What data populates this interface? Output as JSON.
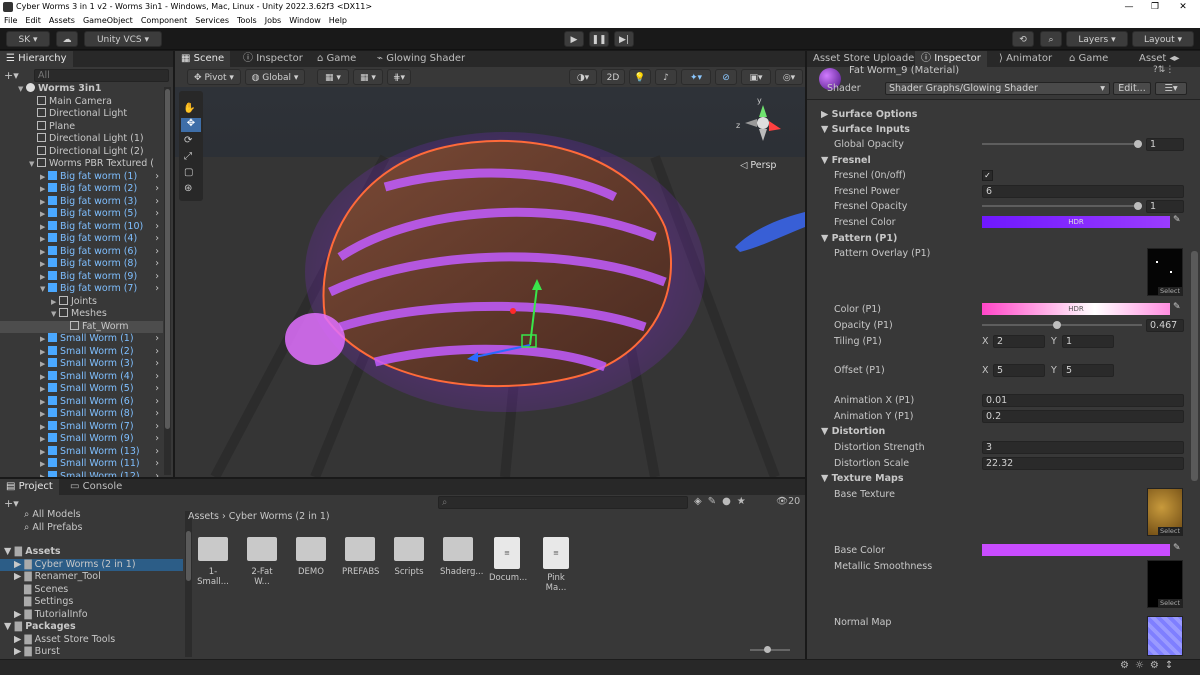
{
  "window": {
    "title": "Cyber Worms 3 in 1 v2 - Worms 3in1 - Windows, Mac, Linux - Unity 2022.3.62f3 <DX11>"
  },
  "menu": [
    "File",
    "Edit",
    "Assets",
    "GameObject",
    "Component",
    "Services",
    "Tools",
    "Jobs",
    "Window",
    "Help"
  ],
  "toolbar": {
    "account": "SK",
    "vcs": "Unity VCS",
    "layers": "Layers",
    "layout": "Layout"
  },
  "hierarchy": {
    "tab": "Hierarchy",
    "search_placeholder": "All",
    "rows": [
      {
        "label": "Worms 3in1",
        "kind": "scene",
        "indent": 0,
        "arrow": "▼"
      },
      {
        "label": "Main Camera",
        "kind": "obj",
        "indent": 1,
        "arrow": ""
      },
      {
        "label": "Directional Light",
        "kind": "obj",
        "indent": 1,
        "arrow": ""
      },
      {
        "label": "Plane",
        "kind": "obj",
        "indent": 1,
        "arrow": ""
      },
      {
        "label": "Directional Light (1)",
        "kind": "obj",
        "indent": 1,
        "arrow": ""
      },
      {
        "label": "Directional Light (2)",
        "kind": "obj",
        "indent": 1,
        "arrow": ""
      },
      {
        "label": "Worms PBR Textured (",
        "kind": "obj",
        "indent": 1,
        "arrow": "▼"
      },
      {
        "label": "Big fat worm (1)",
        "kind": "prefab",
        "indent": 2,
        "arrow": "▶"
      },
      {
        "label": "Big fat worm (2)",
        "kind": "prefab",
        "indent": 2,
        "arrow": "▶"
      },
      {
        "label": "Big fat worm (3)",
        "kind": "prefab",
        "indent": 2,
        "arrow": "▶"
      },
      {
        "label": "Big fat worm (5)",
        "kind": "prefab",
        "indent": 2,
        "arrow": "▶"
      },
      {
        "label": "Big fat worm (10)",
        "kind": "prefab",
        "indent": 2,
        "arrow": "▶"
      },
      {
        "label": "Big fat worm (4)",
        "kind": "prefab",
        "indent": 2,
        "arrow": "▶"
      },
      {
        "label": "Big fat worm (6)",
        "kind": "prefab",
        "indent": 2,
        "arrow": "▶"
      },
      {
        "label": "Big fat worm (8)",
        "kind": "prefab",
        "indent": 2,
        "arrow": "▶"
      },
      {
        "label": "Big fat worm (9)",
        "kind": "prefab",
        "indent": 2,
        "arrow": "▶"
      },
      {
        "label": "Big fat worm (7)",
        "kind": "prefab",
        "indent": 2,
        "arrow": "▼"
      },
      {
        "label": "Joints",
        "kind": "obj",
        "indent": 3,
        "arrow": "▶"
      },
      {
        "label": "Meshes",
        "kind": "obj",
        "indent": 3,
        "arrow": "▼"
      },
      {
        "label": "Fat_Worm",
        "kind": "obj",
        "indent": 4,
        "arrow": "",
        "selected": true
      },
      {
        "label": "Small Worm (1)",
        "kind": "prefab",
        "indent": 2,
        "arrow": "▶"
      },
      {
        "label": "Small Worm (2)",
        "kind": "prefab",
        "indent": 2,
        "arrow": "▶"
      },
      {
        "label": "Small Worm (3)",
        "kind": "prefab",
        "indent": 2,
        "arrow": "▶"
      },
      {
        "label": "Small Worm (4)",
        "kind": "prefab",
        "indent": 2,
        "arrow": "▶"
      },
      {
        "label": "Small Worm (5)",
        "kind": "prefab",
        "indent": 2,
        "arrow": "▶"
      },
      {
        "label": "Small Worm (6)",
        "kind": "prefab",
        "indent": 2,
        "arrow": "▶"
      },
      {
        "label": "Small Worm (8)",
        "kind": "prefab",
        "indent": 2,
        "arrow": "▶"
      },
      {
        "label": "Small Worm (7)",
        "kind": "prefab",
        "indent": 2,
        "arrow": "▶"
      },
      {
        "label": "Small Worm (9)",
        "kind": "prefab",
        "indent": 2,
        "arrow": "▶"
      },
      {
        "label": "Small Worm (13)",
        "kind": "prefab",
        "indent": 2,
        "arrow": "▶"
      },
      {
        "label": "Small Worm (11)",
        "kind": "prefab",
        "indent": 2,
        "arrow": "▶"
      },
      {
        "label": "Small Worm (12)",
        "kind": "prefab",
        "indent": 2,
        "arrow": "▶"
      }
    ]
  },
  "scene": {
    "tabs": [
      "Scene",
      "Inspector",
      "Game",
      "Glowing Shader"
    ],
    "pivot": "Pivot",
    "global": "Global",
    "mode2d": "2D",
    "persp": "Persp"
  },
  "project": {
    "tabs": [
      "Project",
      "Console"
    ],
    "favorites": [
      "All Models",
      "All Prefabs"
    ],
    "assets_label": "Assets",
    "asset_items": [
      "Cyber Worms (2 in 1)",
      "Renamer_Tool",
      "Scenes",
      "Settings",
      "TutorialInfo"
    ],
    "packages_label": "Packages",
    "package_items": [
      "Asset Store Tools",
      "Burst"
    ],
    "breadcrumb": [
      "Assets",
      "Cyber Worms (2 in 1)"
    ],
    "files": [
      {
        "name": "1-Small...",
        "type": "folder"
      },
      {
        "name": "2-Fat W...",
        "type": "folder"
      },
      {
        "name": "DEMO",
        "type": "folder"
      },
      {
        "name": "PREFABS",
        "type": "folder"
      },
      {
        "name": "Scripts",
        "type": "folder"
      },
      {
        "name": "Shaderg...",
        "type": "folder"
      },
      {
        "name": "Docum...",
        "type": "doc"
      },
      {
        "name": "Pink Ma...",
        "type": "doc"
      }
    ],
    "count": "20"
  },
  "inspector": {
    "tabs": [
      "Asset Store Uploader",
      "Inspector",
      "Animator",
      "Game",
      "Asset"
    ],
    "material_name": "Fat Worm_9 (Material)",
    "shader_label": "Shader",
    "shader_value": "Shader Graphs/Glowing Shader",
    "edit_label": "Edit...",
    "sections": {
      "surface_options": "Surface Options",
      "surface_inputs": "Surface Inputs",
      "fresnel": "Fresnel",
      "pattern": "Pattern (P1)",
      "distortion": "Distortion",
      "texture_maps": "Texture Maps"
    },
    "global_opacity": {
      "label": "Global Opacity",
      "value": "1",
      "fraction": 1.0
    },
    "fresnel_toggle": {
      "label": "Fresnel (0n/off)",
      "checked": "✓"
    },
    "fresnel_power": {
      "label": "Fresnel Power",
      "value": "6"
    },
    "fresnel_opacity": {
      "label": "Fresnel Opacity",
      "value": "1",
      "fraction": 1.0
    },
    "fresnel_color": {
      "label": "Fresnel Color",
      "hdr": "HDR"
    },
    "pattern_overlay": {
      "label": "Pattern Overlay (P1)",
      "select": "Select"
    },
    "color_p1": {
      "label": "Color (P1)",
      "hdr": "HDR"
    },
    "opacity_p1": {
      "label": "Opacity (P1)",
      "value": "0.467",
      "fraction": 0.467
    },
    "tiling_p1": {
      "label": "Tiling (P1)",
      "x_label": "X",
      "x": "2",
      "y_label": "Y",
      "y": "1"
    },
    "offset_p1": {
      "label": "Offset (P1)",
      "x_label": "X",
      "x": "5",
      "y_label": "Y",
      "y": "5"
    },
    "anim_x": {
      "label": "Animation X (P1)",
      "value": "0.01"
    },
    "anim_y": {
      "label": "Animation Y (P1)",
      "value": "0.2"
    },
    "dist_strength": {
      "label": "Distortion Strength",
      "value": "3"
    },
    "dist_scale": {
      "label": "Distortion Scale",
      "value": "22.32"
    },
    "base_texture": {
      "label": "Base Texture",
      "select": "Select"
    },
    "base_color": {
      "label": "Base Color"
    },
    "metallic": {
      "label": "Metallic Smoothness",
      "select": "Select"
    },
    "normal_map": {
      "label": "Normal Map"
    }
  },
  "colors": {
    "prefab": "#7fbfff",
    "fresnel": "#8a2bff",
    "pattern_color": "#ff4fd0",
    "base_color": "#c94cff"
  }
}
